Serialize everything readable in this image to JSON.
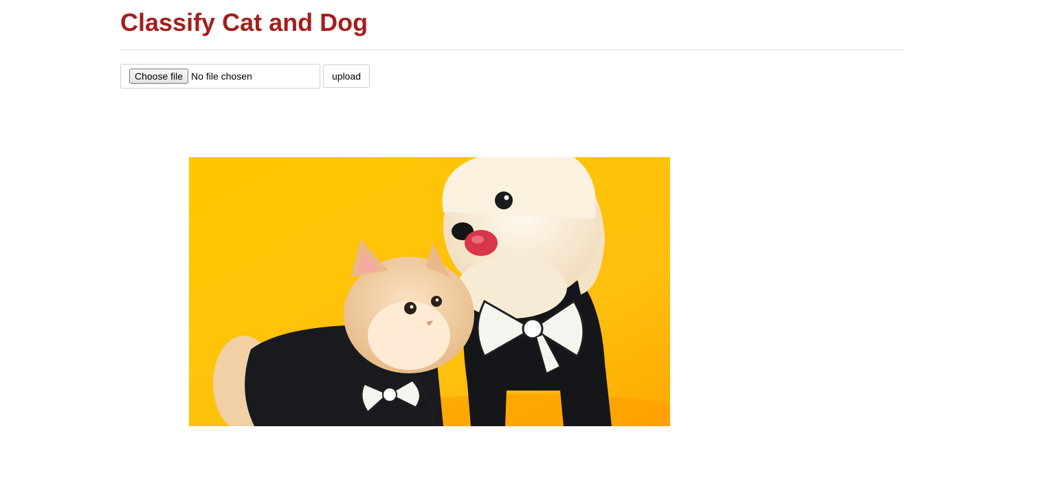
{
  "page": {
    "title": "Classify Cat and Dog",
    "title_color": "#a31f1f"
  },
  "form": {
    "choose_label": "Choose file",
    "file_status": "No file chosen",
    "upload_label": "upload"
  },
  "preview": {
    "subject": "cat and dog in black sweaters with white bows on yellow background"
  }
}
